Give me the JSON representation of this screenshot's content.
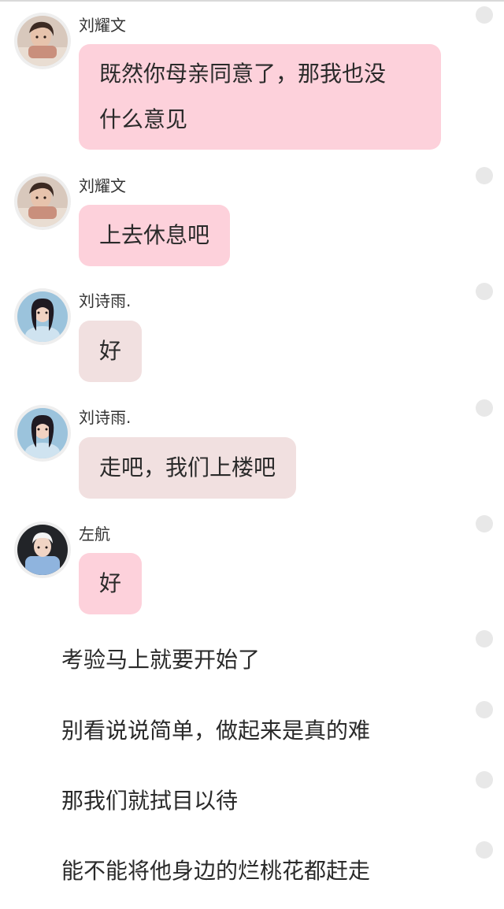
{
  "messages": [
    {
      "sender": "刘耀文",
      "text_lines": [
        "既然你母亲同意了，那我也没",
        "什么意见"
      ],
      "bubble_color": "#fdd1db",
      "avatar": "male-avatar-liu-yaowen"
    },
    {
      "sender": "刘耀文",
      "text_lines": [
        "上去休息吧"
      ],
      "bubble_color": "#fdd1db",
      "avatar": "male-avatar-liu-yaowen"
    },
    {
      "sender": "刘诗雨.",
      "text_lines": [
        "好"
      ],
      "bubble_color": "#f1e0e0",
      "avatar": "female-avatar-liu-shiyu"
    },
    {
      "sender": "刘诗雨.",
      "text_lines": [
        "走吧，我们上楼吧"
      ],
      "bubble_color": "#f1e0e0",
      "avatar": "female-avatar-liu-shiyu"
    },
    {
      "sender": "左航",
      "text_lines": [
        "好"
      ],
      "bubble_color": "#fdd1db",
      "avatar": "male-avatar-zuo-hang"
    }
  ],
  "narration": [
    "考验马上就要开始了",
    "别看说说简单，做起来是真的难",
    "那我们就拭目以待",
    "能不能将他身边的烂桃花都赶走"
  ],
  "colors": {
    "pink_bubble": "#fdd1db",
    "beige_bubble": "#f1e0e0",
    "more_dot": "#e8e8e8"
  }
}
